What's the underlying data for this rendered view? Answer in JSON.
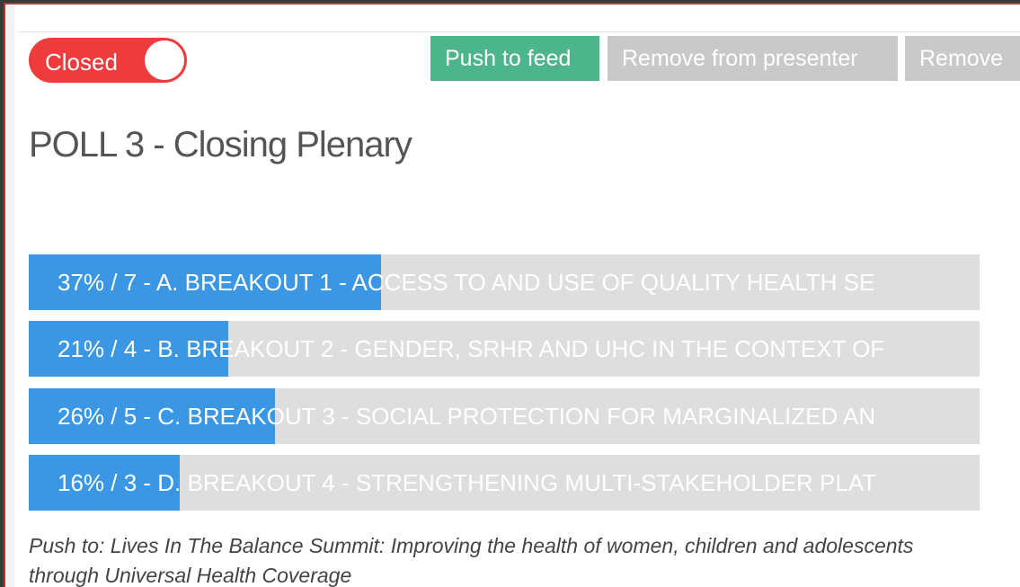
{
  "toggle": {
    "label": "Closed",
    "state": "closed"
  },
  "actions": {
    "push_feed": "Push to feed",
    "remove_presenter": "Remove from presenter",
    "remove": "Remove"
  },
  "poll": {
    "title": "POLL 3 - Closing Plenary",
    "options": [
      {
        "text": "37% / 7 - A. BREAKOUT 1 - ACCESS TO AND USE OF QUALITY HEALTH SE",
        "percent": 37
      },
      {
        "text": "21% / 4 - B. BREAKOUT 2 - GENDER, SRHR AND UHC IN THE CONTEXT OF",
        "percent": 21
      },
      {
        "text": "26% / 5 - C. BREAKOUT 3 - SOCIAL PROTECTION FOR MARGINALIZED AN",
        "percent": 26
      },
      {
        "text": "16% / 3 - D. BREAKOUT 4 - STRENGTHENING MULTI-STAKEHOLDER PLAT",
        "percent": 16
      }
    ]
  },
  "push_to": "Push to: Lives In The Balance Summit: Improving the health of women, children and adolescents through Universal Health Coverage",
  "colors": {
    "toggle_off": "#ee3b3b",
    "push_button": "#4cb58c",
    "disabled_button": "#c9c9c9",
    "bar_fill": "#3b97e3",
    "bar_track": "#dedede"
  }
}
